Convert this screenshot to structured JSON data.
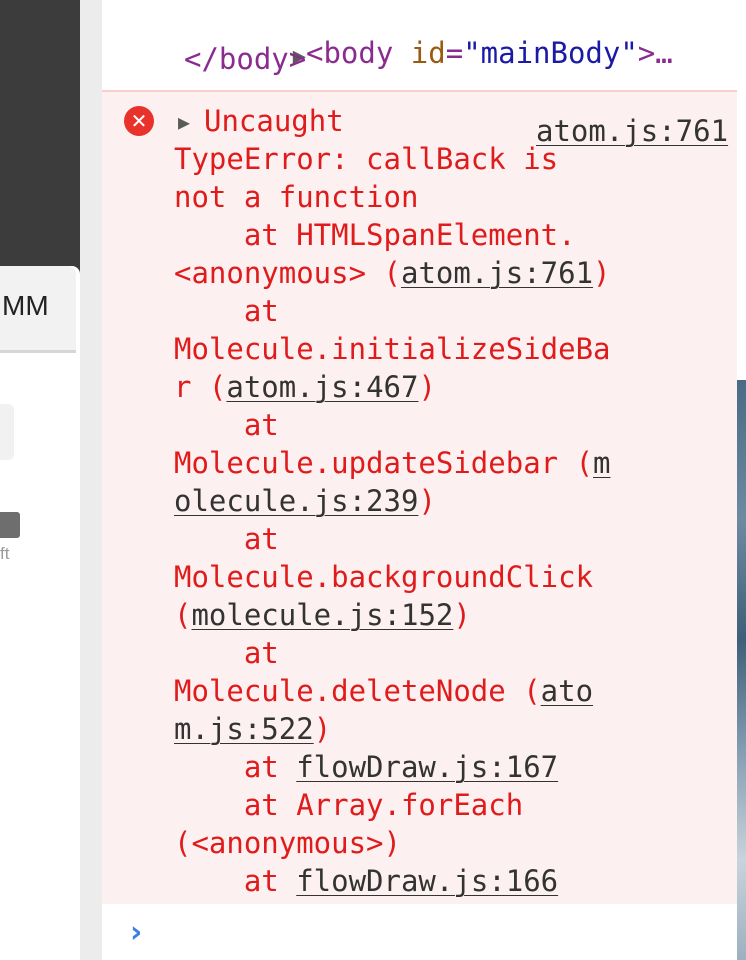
{
  "page_behind": {
    "tab_label": "MM",
    "hint_text": "ft"
  },
  "elements": {
    "body_open": {
      "tag_open": "<body",
      "attr_name": "id",
      "attr_value": "\"mainBody\"",
      "tag_close": ">…"
    },
    "body_close": "</body>"
  },
  "error": {
    "icon": "error-x-icon",
    "source_link": "atom.js:761",
    "lines": [
      {
        "segments": [
          {
            "text": "Uncaught",
            "link": false
          }
        ]
      },
      {
        "segments": [
          {
            "text": "TypeError: callBack is",
            "link": false
          }
        ]
      },
      {
        "segments": [
          {
            "text": "not a function",
            "link": false
          }
        ]
      },
      {
        "segments": [
          {
            "text": "    at HTMLSpanElement.",
            "link": false
          }
        ]
      },
      {
        "segments": [
          {
            "text": "<anonymous> (",
            "link": false
          },
          {
            "text": "atom.js:761",
            "link": true
          },
          {
            "text": ")",
            "link": false
          }
        ]
      },
      {
        "segments": [
          {
            "text": "    at",
            "link": false
          }
        ]
      },
      {
        "segments": [
          {
            "text": "Molecule.initializeSideBa",
            "link": false
          }
        ]
      },
      {
        "segments": [
          {
            "text": "r (",
            "link": false
          },
          {
            "text": "atom.js:467",
            "link": true
          },
          {
            "text": ")",
            "link": false
          }
        ]
      },
      {
        "segments": [
          {
            "text": "    at",
            "link": false
          }
        ]
      },
      {
        "segments": [
          {
            "text": "Molecule.updateSidebar (",
            "link": false
          },
          {
            "text": "m",
            "link": true
          }
        ]
      },
      {
        "segments": [
          {
            "text": "olecule.js:239",
            "link": true
          },
          {
            "text": ")",
            "link": false
          }
        ]
      },
      {
        "segments": [
          {
            "text": "    at",
            "link": false
          }
        ]
      },
      {
        "segments": [
          {
            "text": "Molecule.backgroundClick",
            "link": false
          }
        ]
      },
      {
        "segments": [
          {
            "text": "(",
            "link": false
          },
          {
            "text": "molecule.js:152",
            "link": true
          },
          {
            "text": ")",
            "link": false
          }
        ]
      },
      {
        "segments": [
          {
            "text": "    at",
            "link": false
          }
        ]
      },
      {
        "segments": [
          {
            "text": "Molecule.deleteNode (",
            "link": false
          },
          {
            "text": "ato",
            "link": true
          }
        ]
      },
      {
        "segments": [
          {
            "text": "m.js:522",
            "link": true
          },
          {
            "text": ")",
            "link": false
          }
        ]
      },
      {
        "segments": [
          {
            "text": "    at ",
            "link": false
          },
          {
            "text": "flowDraw.js:167",
            "link": true
          }
        ]
      },
      {
        "segments": [
          {
            "text": "    at Array.forEach",
            "link": false
          }
        ]
      },
      {
        "segments": [
          {
            "text": "(<anonymous>)",
            "link": false
          }
        ]
      },
      {
        "segments": [
          {
            "text": "    at ",
            "link": false
          },
          {
            "text": "flowDraw.js:166",
            "link": true
          }
        ]
      }
    ]
  },
  "console_prompt": {
    "icon": "chevron-right-icon"
  },
  "colors": {
    "error_text": "#e01b1b",
    "error_bg": "#fdf0f0",
    "link_text": "#333333",
    "prompt_caret": "#3d7fe6"
  }
}
